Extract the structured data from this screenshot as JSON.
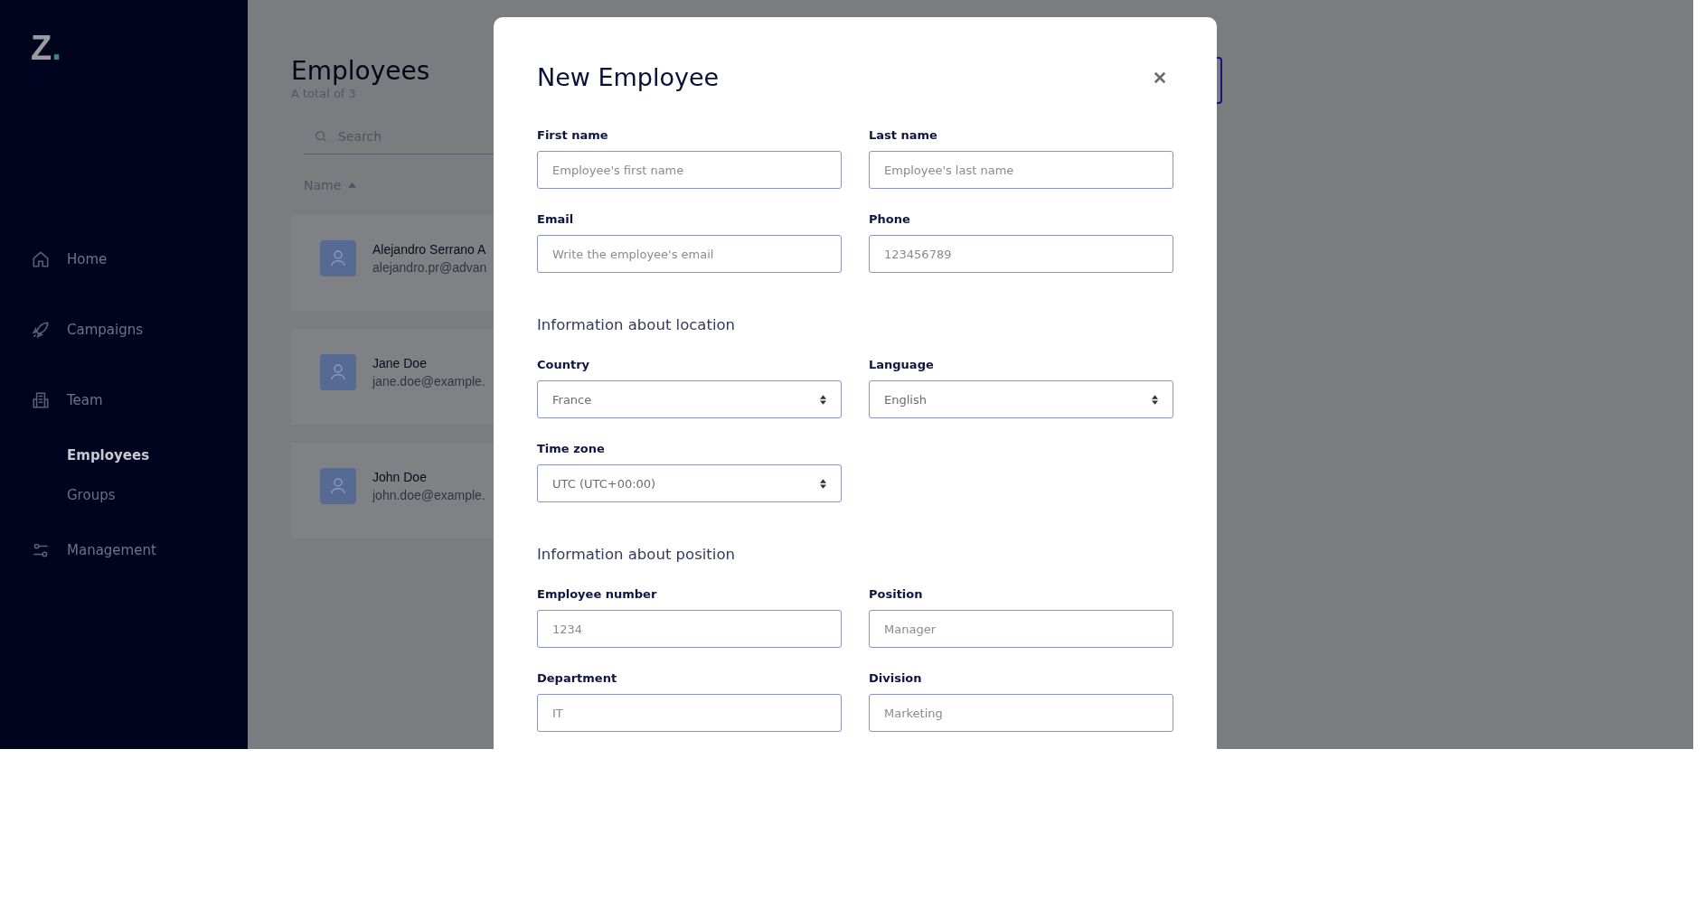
{
  "logo": {
    "letter": "Z",
    "dot": "."
  },
  "sidebar": {
    "items": [
      {
        "label": "Home",
        "selected": false
      },
      {
        "label": "Campaigns",
        "selected": false
      },
      {
        "label": "Team",
        "selected": false,
        "children": [
          {
            "label": "Employees",
            "selected": true
          },
          {
            "label": "Groups",
            "selected": false
          }
        ]
      },
      {
        "label": "Management",
        "selected": false
      }
    ]
  },
  "page": {
    "title": "Employees",
    "subtitle": "A total of 3",
    "search": {
      "placeholder": "Search"
    },
    "sort_column": {
      "label": "Name"
    },
    "employees": [
      {
        "name": "Alejandro Serrano A",
        "email": "alejandro.pr@advan"
      },
      {
        "name": "Jane Doe",
        "email": "jane.doe@example."
      },
      {
        "name": "John Doe",
        "email": "john.doe@example."
      }
    ]
  },
  "modal": {
    "title": "New Employee",
    "sections": [
      {
        "fields": [
          {
            "label": "First name",
            "kind": "text",
            "placeholder": "Employee's first name"
          },
          {
            "label": "Last name",
            "kind": "text",
            "placeholder": "Employee's last name"
          },
          {
            "label": "Email",
            "kind": "text",
            "placeholder": "Write the employee's email"
          },
          {
            "label": "Phone",
            "kind": "text",
            "placeholder": "123456789"
          }
        ]
      },
      {
        "heading": "Information about location",
        "fields": [
          {
            "label": "Country",
            "kind": "select",
            "value": "France"
          },
          {
            "label": "Language",
            "kind": "select",
            "value": "English"
          },
          {
            "label": "Time zone",
            "kind": "select",
            "value": "UTC (UTC+00:00)"
          }
        ]
      },
      {
        "heading": "Information about position",
        "fields": [
          {
            "label": "Employee number",
            "kind": "text",
            "placeholder": "1234"
          },
          {
            "label": "Position",
            "kind": "text",
            "placeholder": "Manager"
          },
          {
            "label": "Department",
            "kind": "text",
            "placeholder": "IT"
          },
          {
            "label": "Division",
            "kind": "text",
            "placeholder": "Marketing"
          }
        ]
      }
    ]
  }
}
